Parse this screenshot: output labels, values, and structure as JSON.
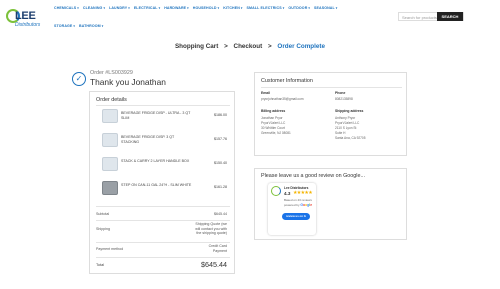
{
  "header": {
    "logo_text": "LEE",
    "logo_subtext": "Distributors",
    "nav_row1": [
      {
        "label": "CHEMICALS"
      },
      {
        "label": "CLEANING"
      },
      {
        "label": "LAUNDRY"
      },
      {
        "label": "ELECTRICAL"
      },
      {
        "label": "HARDWARE"
      },
      {
        "label": "HOUSEHOLD"
      },
      {
        "label": "KITCHEN"
      },
      {
        "label": "SMALL ELECTRICS"
      },
      {
        "label": "OUTDOOR"
      },
      {
        "label": "SEASONAL"
      }
    ],
    "nav_row2": [
      {
        "label": "STORAGE"
      },
      {
        "label": "BATHROOM"
      }
    ],
    "search_placeholder": "Search for products",
    "search_button": "SEARCH"
  },
  "breadcrumb": {
    "step1": "Shopping Cart",
    "sep1": ">",
    "step2": "Checkout",
    "sep2": ">",
    "step3": "Order Complete"
  },
  "order": {
    "number": "Order #LS003929",
    "thanks": "Thank you Jonathan"
  },
  "order_details": {
    "title": "Order details",
    "items": [
      {
        "name": "BEVERAGE FRIDGE DISP - ULTRA - 3 QT SLIM",
        "price": "$186.00"
      },
      {
        "name": "BEVERAGE FRIDGE DISP. 3 QT STACKING",
        "price": "$157.76"
      },
      {
        "name": "STACK & CARRY 2 LAYER HANDLE BOX",
        "price": "$150.40"
      },
      {
        "name": "STEP ON CAN-11 GAL 24\"H - SLIM WHITE",
        "price": "$161.28"
      }
    ],
    "subtotal_label": "Subtotal",
    "subtotal_value": "$645.44",
    "shipping_label": "Shipping",
    "shipping_value": "Shipping Quote (we will contact you with the shipping quote)",
    "payment_label": "Payment method",
    "payment_value": "Credit Card Payment",
    "total_label": "Total",
    "total_value": "$645.44"
  },
  "customer": {
    "title": "Customer Information",
    "email_label": "Email",
    "email_value": "pryorjohnathan35@gmail.com",
    "phone_label": "Phone",
    "phone_value": "8082135898",
    "billing_label": "Billing address",
    "billing_lines": [
      "Jonathan Pryor",
      "PryorVJalert LLC",
      "30 Whittier Court",
      "Greenville, NJ 08081"
    ],
    "shipping_label": "Shipping address",
    "shipping_lines": [
      "Anthony Pryor",
      "PryorVJalert LLC",
      "2110 S Lyon St",
      "Suite H",
      "Santa Ana, CA 92705"
    ]
  },
  "review": {
    "title": "Please leave us a good review on Google...",
    "business": "Lee Distributors",
    "rating": "4.3",
    "stars": "★★★★★",
    "count": "Based on 43 reviews",
    "powered": "powered by",
    "google": "Google",
    "button": "review us on"
  }
}
